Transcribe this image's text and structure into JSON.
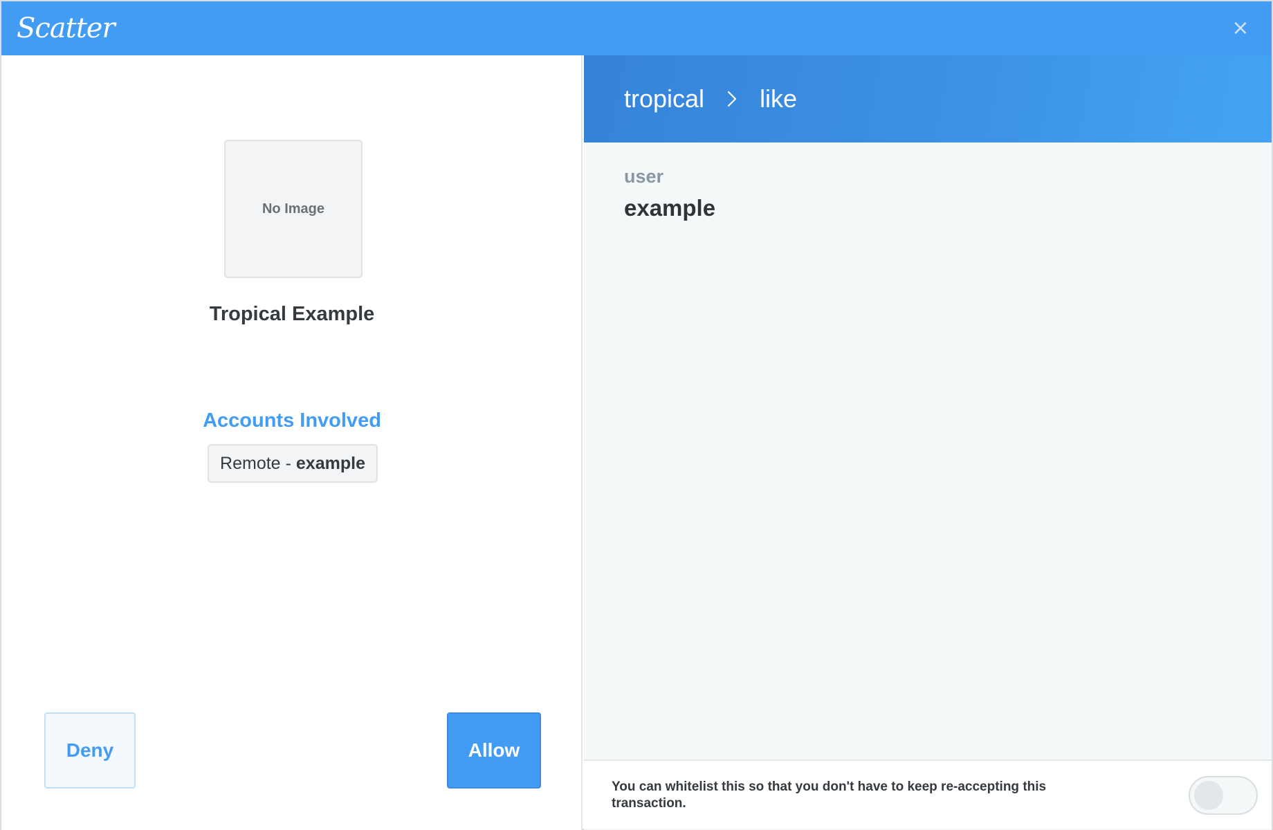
{
  "titlebar": {
    "logo_text": "Scatter",
    "close_glyph": "×",
    "background_color": "#429cf4"
  },
  "app": {
    "image_placeholder": "No Image",
    "name": "Tropical Example"
  },
  "accounts": {
    "heading": "Accounts Involved",
    "items": [
      {
        "network": "Remote",
        "separator": "-",
        "name": "example"
      }
    ]
  },
  "buttons": {
    "deny_label": "Deny",
    "allow_label": "Allow"
  },
  "action": {
    "contract": "tropical",
    "action_name": "like",
    "chevron_icon": "chevron-right-icon"
  },
  "fields": [
    {
      "label": "user",
      "value": "example"
    }
  ],
  "whitelist": {
    "text": "You can whitelist this so that you don't have to keep re-accepting this transaction.",
    "enabled": false
  }
}
